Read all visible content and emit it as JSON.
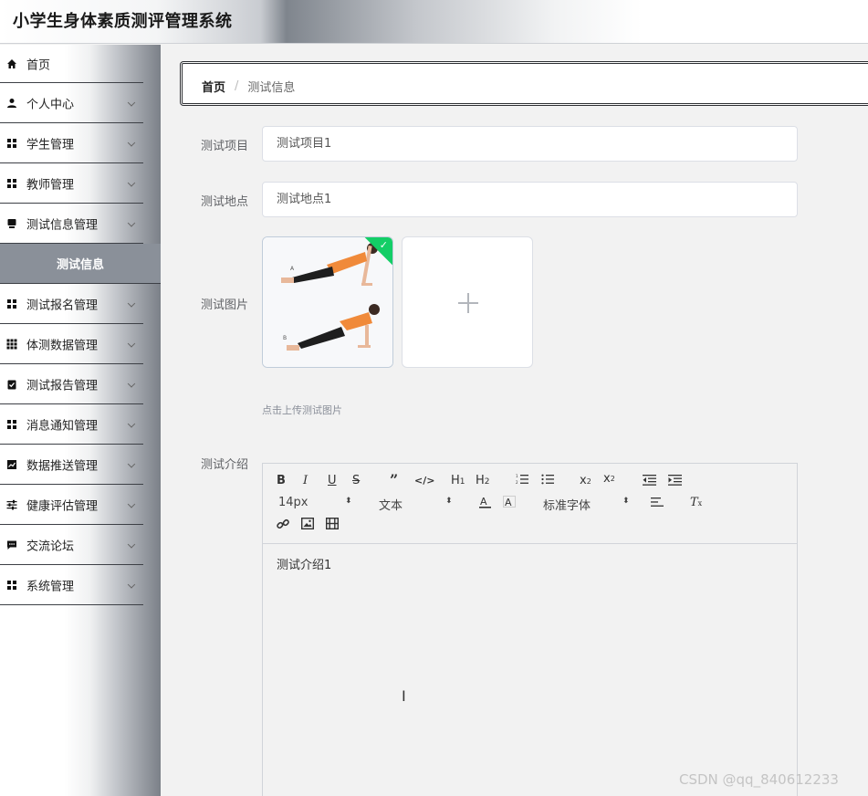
{
  "app": {
    "title": "小学生身体素质测评管理系统"
  },
  "sidebar": {
    "items": [
      {
        "label": "首页",
        "icon": "home-icon",
        "has_arrow": false
      },
      {
        "label": "个人中心",
        "icon": "user-icon",
        "has_arrow": true
      },
      {
        "label": "学生管理",
        "icon": "grid-icon",
        "has_arrow": true
      },
      {
        "label": "教师管理",
        "icon": "grid-icon",
        "has_arrow": true
      },
      {
        "label": "测试信息管理",
        "icon": "inbox-icon",
        "has_arrow": true
      }
    ],
    "active_sub": "测试信息",
    "items_after": [
      {
        "label": "测试报名管理",
        "icon": "grid-icon"
      },
      {
        "label": "体测数据管理",
        "icon": "apps-icon"
      },
      {
        "label": "测试报告管理",
        "icon": "clipboard-check-icon"
      },
      {
        "label": "消息通知管理",
        "icon": "grid-icon"
      },
      {
        "label": "数据推送管理",
        "icon": "chart-icon"
      },
      {
        "label": "健康评估管理",
        "icon": "sliders-icon"
      },
      {
        "label": "交流论坛",
        "icon": "chat-icon"
      },
      {
        "label": "系统管理",
        "icon": "grid-icon"
      }
    ]
  },
  "breadcrumb": {
    "home": "首页",
    "separator": "/",
    "current": "测试信息"
  },
  "form": {
    "project_label": "测试项目",
    "project_value": "测试项目1",
    "location_label": "测试地点",
    "location_value": "测试地点1",
    "image_label": "测试图片",
    "upload_tip": "点击上传测试图片",
    "intro_label": "测试介绍",
    "intro_value": "测试介绍1"
  },
  "editor": {
    "font_size": "14px",
    "header_select": "文本",
    "font_family": "标准字体"
  },
  "colors": {
    "success": "#13ce66",
    "active_menu": "#8a9099"
  },
  "watermark": "CSDN @qq_840612233"
}
